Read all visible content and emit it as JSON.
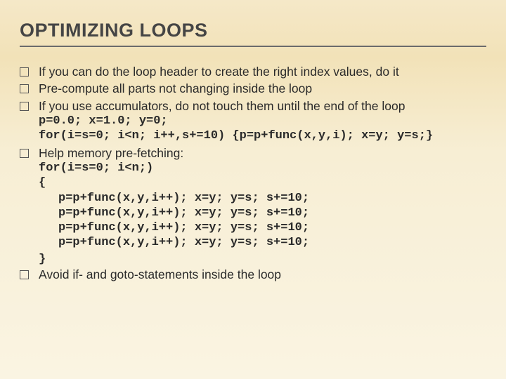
{
  "title": "OPTIMIZING LOOPS",
  "bullets": {
    "b1": "If you can do the loop header to create the right index values, do it",
    "b2": "Pre-compute all parts not changing inside the loop",
    "b3_text": "If you use accumulators, do not touch them until the end of the loop",
    "b3_code1": "p=0.0; x=1.0; y=0;",
    "b3_code2": "for(i=s=0; i<n; i++,s+=10) {p=p+func(x,y,i); x=y; y=s;}",
    "b4_text": "Help memory pre-fetching:",
    "b4_code1": "for(i=s=0; i<n;)",
    "b4_code2": "{",
    "b4_line1": "p=p+func(x,y,i++); x=y; y=s; s+=10;",
    "b4_line2": "p=p+func(x,y,i++); x=y; y=s; s+=10;",
    "b4_line3": "p=p+func(x,y,i++); x=y; y=s; s+=10;",
    "b4_line4": "p=p+func(x,y,i++); x=y; y=s; s+=10;",
    "b4_close": "}",
    "b5": "Avoid if- and goto-statements inside the loop"
  }
}
